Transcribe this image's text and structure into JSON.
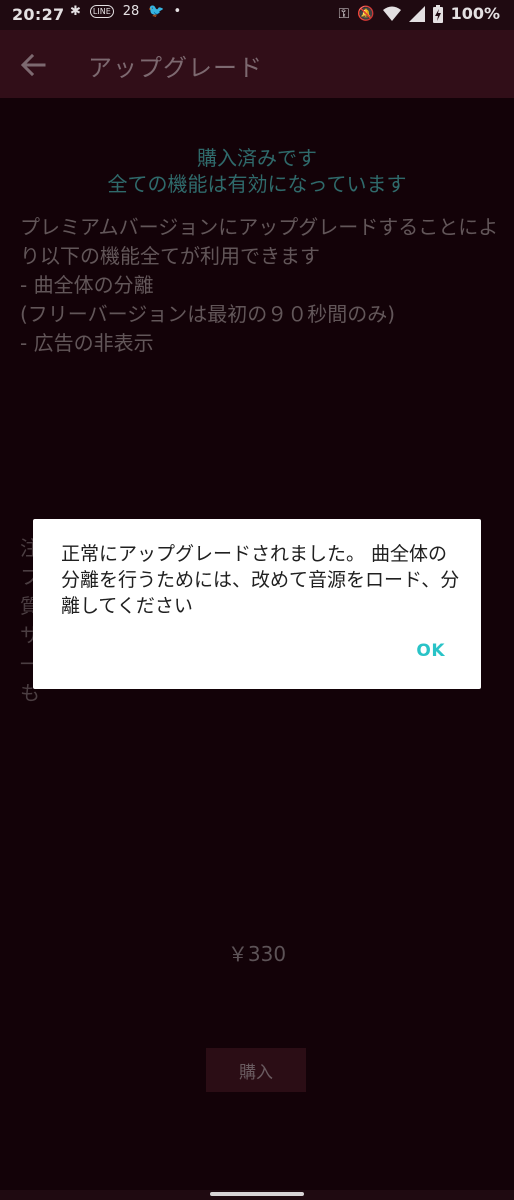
{
  "status_bar": {
    "time": "20:27",
    "notification_badge": "28",
    "battery_percent": "100%",
    "icons": [
      "bug-icon",
      "line-app-icon",
      "twitter-icon",
      "dot-icon",
      "vpn-key-icon",
      "mute-bell-icon",
      "wifi-icon",
      "signal-icon",
      "battery-charging-icon"
    ]
  },
  "app_bar": {
    "title": "アップグレード",
    "back_icon": "back-arrow-icon"
  },
  "purchase_status": {
    "line1": "購入済みです",
    "line2": "全ての機能は有効になっています"
  },
  "description": {
    "text": "プレミアムバージョンにアップグレードすることにより以下の機能全てが利用できます\n - 曲全体の分離\n   (フリーバージョンは最初の９０秒間のみ)\n - 広告の非表示"
  },
  "background_notice": {
    "chars": "注\nフ\n質\nサ\n一\nも"
  },
  "price": "￥330",
  "buy_button": "購入",
  "dialog": {
    "message": "正常にアップグレードされました。 曲全体の分離を行うためには、改めて音源をロード、分離してください",
    "ok_label": "OK"
  },
  "colors": {
    "background": "#12020a",
    "app_bar": "#310e18",
    "accent_teal": "#29c3c7"
  }
}
